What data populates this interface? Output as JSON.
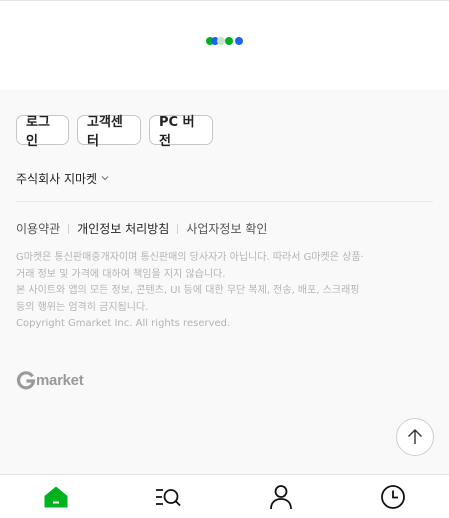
{
  "loader": {
    "dot_colors": [
      "#00b31e",
      "#1e64e6",
      "#c6e4c8",
      "#00b31e",
      "#1e64e6"
    ]
  },
  "footer": {
    "buttons": {
      "login": "로그인",
      "customer_center": "고객센터",
      "pc_version": "PC 버전"
    },
    "company": {
      "name": "주식회사 지마켓",
      "icon": "chevron-down-icon"
    },
    "links": {
      "terms": "이용약관",
      "privacy": "개인정보 처리방침",
      "business_info": "사업자정보 확인"
    },
    "notice": {
      "line1": "G마켓은 통신판매중개자이며 통신판매의 당사자가 아닙니다. 따라서 G마켓은 상품·",
      "line2": "거래 정보 및 가격에 대하여 책임을 지지 않습니다.",
      "line3": "본 사이트와 앱의 모든 정보, 콘텐츠, UI 등에 대한 무단 복제, 전송, 배포, 스크래핑",
      "line4": "등의 행위는 엄격히 금지됩니다.",
      "line5": "Copyright Gmarket Inc. All rights reserved."
    },
    "logo_text": "market",
    "scroll_top_icon": "arrow-up-icon"
  },
  "tabbar": {
    "accent_color": "#00b31e",
    "tabs": [
      {
        "icon": "home-icon",
        "active": true
      },
      {
        "icon": "category-search-icon",
        "active": false
      },
      {
        "icon": "user-icon",
        "active": false
      },
      {
        "icon": "recent-clock-icon",
        "active": false
      }
    ]
  }
}
